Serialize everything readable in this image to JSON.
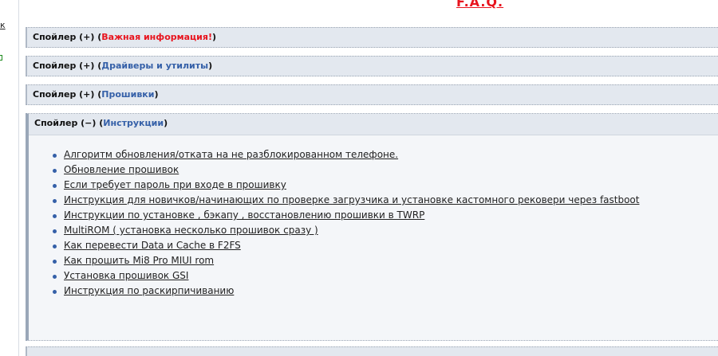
{
  "sidebar": {
    "link_fragment": "к"
  },
  "faq_title": "F.A.Q.",
  "spoilers": [
    {
      "label": "Спойлер (+) (",
      "tag": "Важная информация!",
      "tail": ")"
    },
    {
      "label": "Спойлер (+) (",
      "tag": "Драйверы и утилиты",
      "tail": ")"
    },
    {
      "label": "Спойлер (+) (",
      "tag": "Прошивки",
      "tail": ")"
    },
    {
      "label": "Спойлер (−) (",
      "tag": "Инструкции",
      "tail": ")"
    }
  ],
  "instructions": [
    "Алгоритм обновления/отката на не разблокированном телефоне.",
    "Обновление прошивок",
    "Если требует пароль при входе в прошивку",
    "Инструкция для новичков/начинающих по проверке загрузчика и установке кастомного рековери через fastboot",
    "Инструкции по установке , бэкапу , восстановлению прошивки в TWRP",
    "MultiROM ( установка несколько прошивок сразу )",
    "Как перевести Data и Cache в F2FS",
    "Как прошить Mi8 Pro MIUI rom",
    "Установка прошивок GSI",
    "Инструкция по раскирпичиванию"
  ],
  "colors": {
    "accent_red": "#e8141e",
    "accent_blue": "#3560a8",
    "spoiler_bg": "#e3e8ef"
  }
}
